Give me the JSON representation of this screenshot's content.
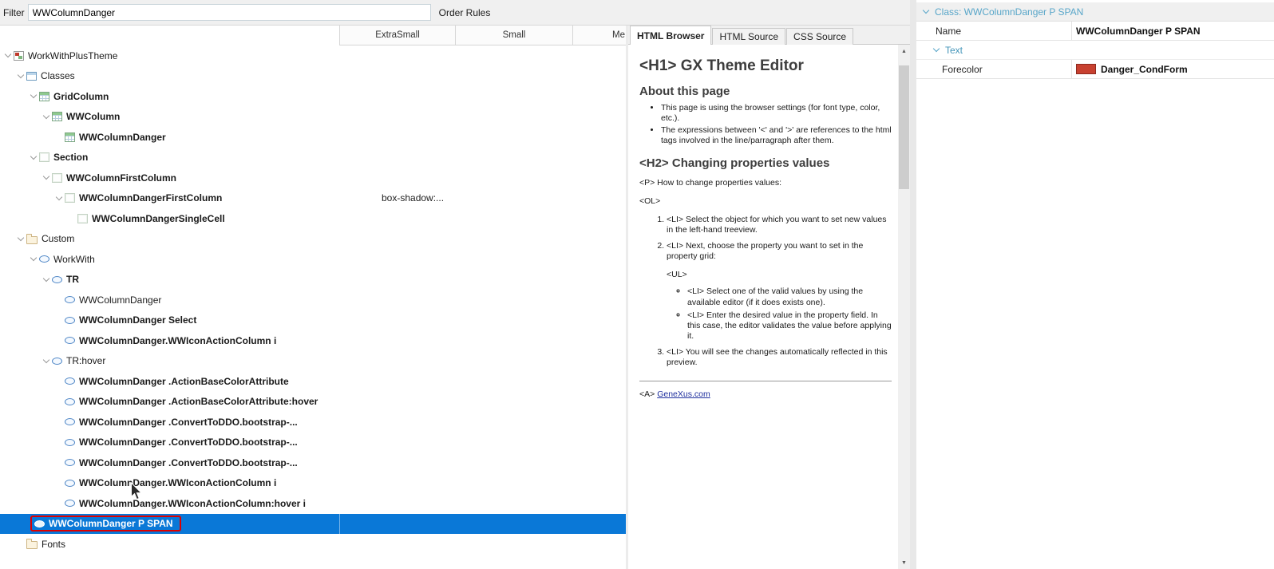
{
  "colors": {
    "selection_blue": "#0a78d7",
    "highlight_red": "#dd0000",
    "panel_header_teal": "#58a6c9",
    "swatch_red": "#c84130",
    "link_blue": "#1f2f9e"
  },
  "topbar": {
    "filter_label": "Filter",
    "filter_value": "WWColumnDanger",
    "order_rules_label": "Order Rules"
  },
  "columns": {
    "extra_small": "ExtraSmall",
    "small": "Small",
    "medium": "Me"
  },
  "tree": {
    "items": [
      {
        "label": "WorkWithPlusTheme"
      },
      {
        "label": "Classes"
      },
      {
        "label": "GridColumn"
      },
      {
        "label": "WWColumn"
      },
      {
        "label": "WWColumnDanger"
      },
      {
        "label": "Section"
      },
      {
        "label": "WWColumnFirstColumn"
      },
      {
        "label": "WWColumnDangerFirstColumn",
        "value": "box-shadow:..."
      },
      {
        "label": "WWColumnDangerSingleCell"
      },
      {
        "label": "Custom"
      },
      {
        "label": "WorkWith"
      },
      {
        "label": "TR"
      },
      {
        "label": "WWColumnDanger"
      },
      {
        "label": "WWColumnDanger Select"
      },
      {
        "label": "WWColumnDanger.WWIconActionColumn i"
      },
      {
        "label": "TR:hover"
      },
      {
        "label": "WWColumnDanger .ActionBaseColorAttribute"
      },
      {
        "label": "WWColumnDanger .ActionBaseColorAttribute:hover"
      },
      {
        "label": "WWColumnDanger .ConvertToDDO.bootstrap-..."
      },
      {
        "label": "WWColumnDanger .ConvertToDDO.bootstrap-..."
      },
      {
        "label": "WWColumnDanger .ConvertToDDO.bootstrap-..."
      },
      {
        "label": "WWColumnDanger.WWIconActionColumn i"
      },
      {
        "label": "WWColumnDanger.WWIconActionColumn:hover i"
      },
      {
        "label": "WWColumnDanger P SPAN",
        "selected": true
      },
      {
        "label": "Fonts"
      }
    ]
  },
  "browser": {
    "tabs": [
      "HTML Browser",
      "HTML Source",
      "CSS Source"
    ],
    "h1": "<H1> GX Theme Editor",
    "about_heading": "About this page",
    "about_bullets": [
      "This page is using the browser settings (for font type, color, etc.).",
      "The expressions between '<' and '>' are references to the html tags involved in the line/parragraph after them."
    ],
    "h2": "<H2> Changing properties values",
    "p_line": "<P> How to change properties values:",
    "ol_tag": "<OL>",
    "ol_items": [
      "<LI> Select the object for which you want to set new values in the left-hand treeview.",
      "<LI> Next, choose the property you want to set in the property grid:",
      "<LI> You will see the changes automatically reflected in this preview."
    ],
    "ul_tag": "<UL>",
    "ul_items": [
      "<LI> Select one of the valid values by using the available editor (if it does exists one).",
      "<LI> Enter the desired value in the property field. In this case, the editor validates the value before applying it."
    ],
    "a_prefix": "<A>",
    "link_text": "GeneXus.com"
  },
  "property_grid": {
    "header": "Class: WWColumnDanger P SPAN",
    "name_label": "Name",
    "name_value": "WWColumnDanger P SPAN",
    "group_label": "Text",
    "forecolor_label": "Forecolor",
    "forecolor_value": "Danger_CondForm"
  }
}
